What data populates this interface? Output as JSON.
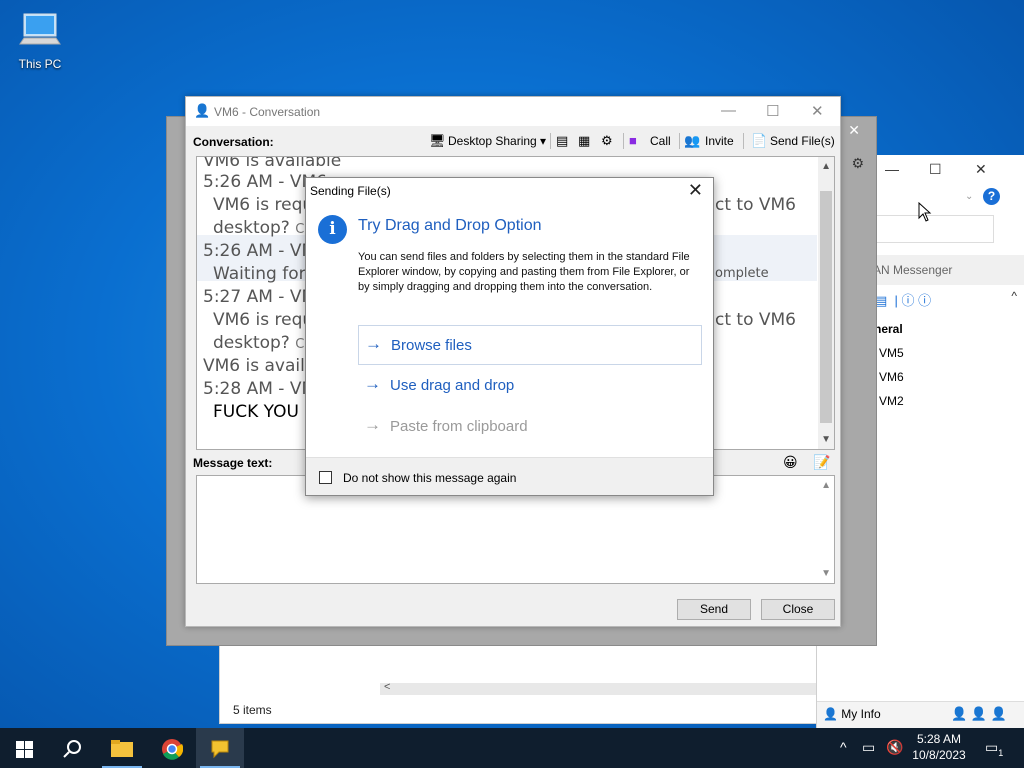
{
  "desktop": {
    "icon_label": "This PC"
  },
  "explorer": {
    "status": "5 items",
    "scroll_left": "<"
  },
  "messenger": {
    "title_partial": "AN Messenger",
    "group": "neral",
    "contacts": [
      "VM5",
      "VM6",
      "VM2"
    ],
    "my_info": "My Info"
  },
  "conversation": {
    "title": "VM6 - Conversation",
    "conversation_label": "Conversation:",
    "toolbar": {
      "desktop_sharing": "Desktop Sharing",
      "call": "Call",
      "invite": "Invite",
      "send_files": "Send File(s)"
    },
    "history": [
      "VM6 is available",
      "5:26 AM - VM6",
      "VM6 is requ",
      "desktop?",
      "5:26 AM - VM",
      "Waiting for",
      "5:27 AM - VM",
      "VM6 is requ",
      "desktop?",
      "VM6 is availa",
      "5:28 AM - VM",
      "FUCK YOU"
    ],
    "history_right": [
      "ct to VM6",
      "omplete",
      "ct to VM6"
    ],
    "history_small": [
      "Co",
      "Co"
    ],
    "message_label": "Message text:",
    "send_button": "Send",
    "close_button": "Close"
  },
  "dialog": {
    "title": "Sending File(s)",
    "heading": "Try Drag and Drop Option",
    "body": "You can send files and folders by selecting them in the standard File Explorer window, by copying and pasting them from File Explorer, or by simply dragging and dropping them into the conversation.",
    "options": [
      "Browse files",
      "Use drag and drop",
      "Paste from clipboard"
    ],
    "checkbox_label": "Do not show this message again",
    "colors": {
      "accent": "#1a6fd6",
      "heading": "#1f5fbf",
      "disabled": "#9a9a9a"
    }
  },
  "taskbar": {
    "time": "5:28 AM",
    "date": "10/8/2023",
    "notification_count": "1"
  }
}
